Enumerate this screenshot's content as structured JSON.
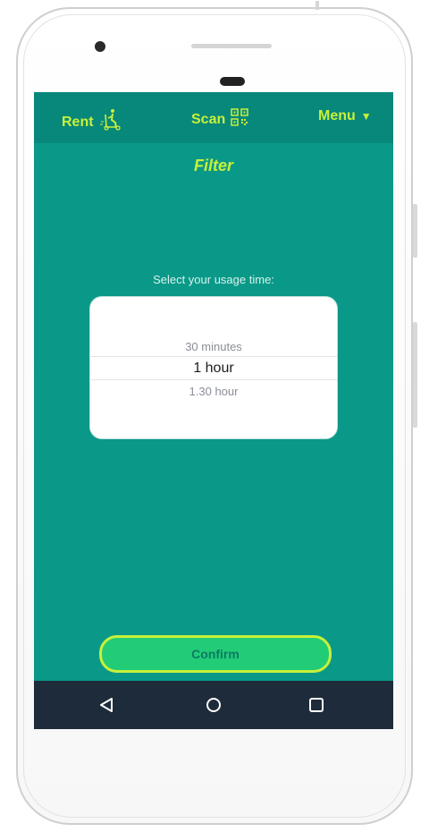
{
  "header": {
    "rent_label": "Rent",
    "scan_label": "Scan",
    "menu_label": "Menu",
    "menu_caret": "▼"
  },
  "page": {
    "title": "Filter",
    "prompt": "Select your usage time:"
  },
  "picker": {
    "options": [
      "30 minutes",
      "1 hour",
      "1.30 hour"
    ],
    "selected": "1 hour"
  },
  "actions": {
    "confirm_label": "Confirm"
  },
  "icons": {
    "rent": "scooter-icon",
    "scan": "qr-code-icon",
    "back": "back-triangle-icon",
    "home": "home-circle-icon",
    "recents": "recents-square-icon"
  },
  "colors": {
    "background": "#0a9988",
    "topbar": "#08887a",
    "accent": "#c8f03a",
    "button": "#22cc77",
    "navbar": "#1e2b3a"
  }
}
